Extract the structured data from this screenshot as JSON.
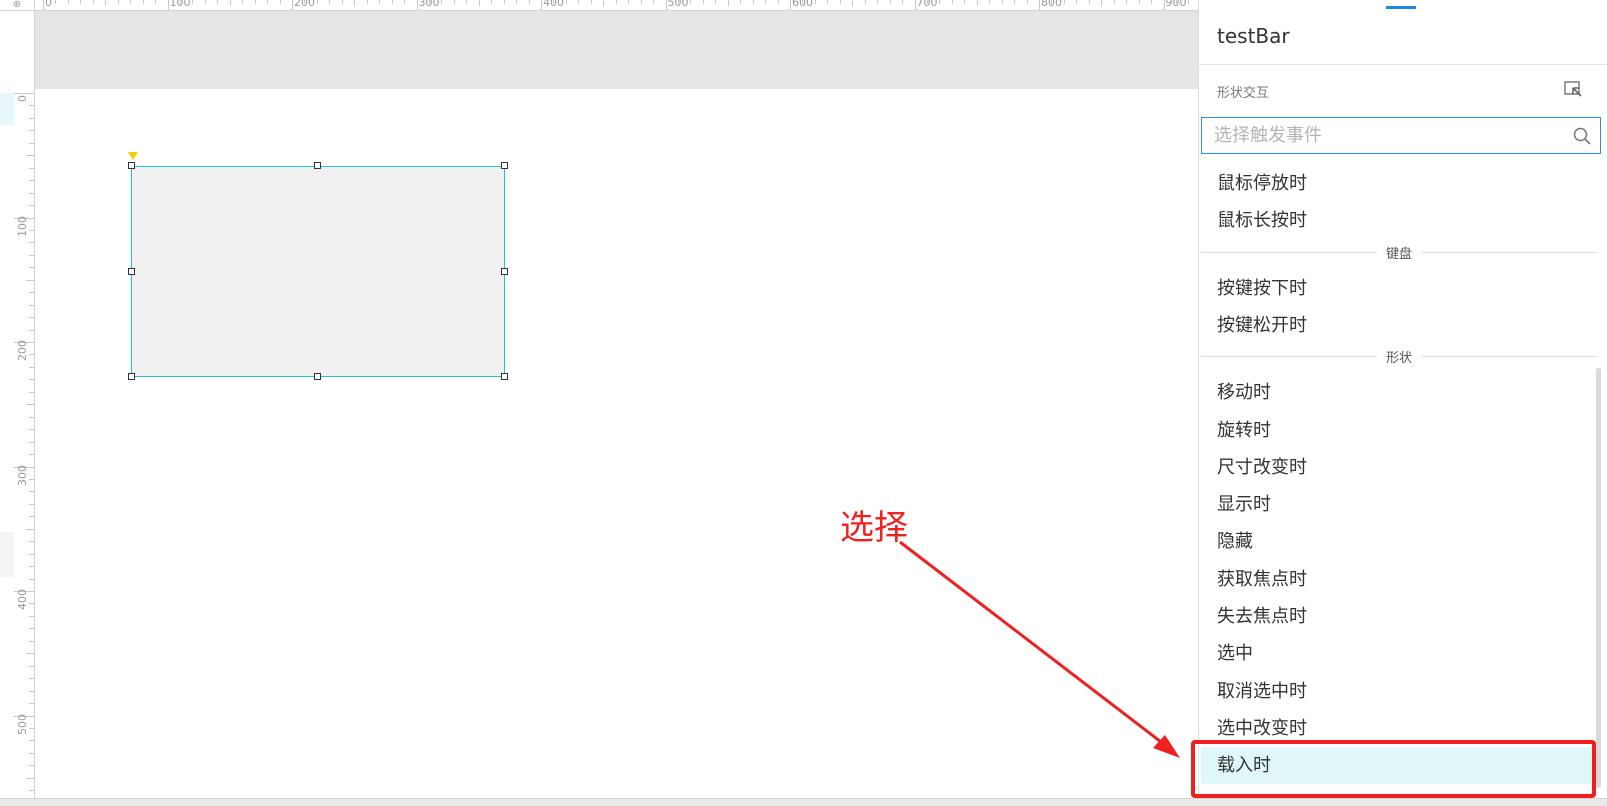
{
  "ruler": {
    "top_labels": [
      "0",
      "100",
      "200",
      "300",
      "400",
      "500",
      "600",
      "700",
      "800",
      "900"
    ],
    "left_labels": [
      "0",
      "100",
      "200",
      "300",
      "400",
      "500"
    ]
  },
  "panel": {
    "title": "testBar",
    "section_label": "形状交互",
    "search_placeholder": "选择触发事件",
    "events": [
      {
        "kind": "item",
        "label": "鼠标停放时"
      },
      {
        "kind": "item",
        "label": "鼠标长按时"
      },
      {
        "kind": "group",
        "label": "键盘"
      },
      {
        "kind": "item",
        "label": "按键按下时"
      },
      {
        "kind": "item",
        "label": "按键松开时"
      },
      {
        "kind": "group",
        "label": "形状"
      },
      {
        "kind": "item",
        "label": "移动时"
      },
      {
        "kind": "item",
        "label": "旋转时"
      },
      {
        "kind": "item",
        "label": "尺寸改变时"
      },
      {
        "kind": "item",
        "label": "显示时"
      },
      {
        "kind": "item",
        "label": "隐藏"
      },
      {
        "kind": "item",
        "label": "获取焦点时"
      },
      {
        "kind": "item",
        "label": "失去焦点时"
      },
      {
        "kind": "item",
        "label": "选中"
      },
      {
        "kind": "item",
        "label": "取消选中时"
      },
      {
        "kind": "item",
        "label": "选中改变时"
      },
      {
        "kind": "item",
        "label": "载入时",
        "highlighted": true
      }
    ]
  },
  "annotation": {
    "text": "选择",
    "color": "#f02020"
  },
  "colors": {
    "selection_border": "#21c5d0",
    "highlight_row": "#dff7f8",
    "search_border": "#2f8fd7",
    "accent_tab": "#1e88e5"
  }
}
